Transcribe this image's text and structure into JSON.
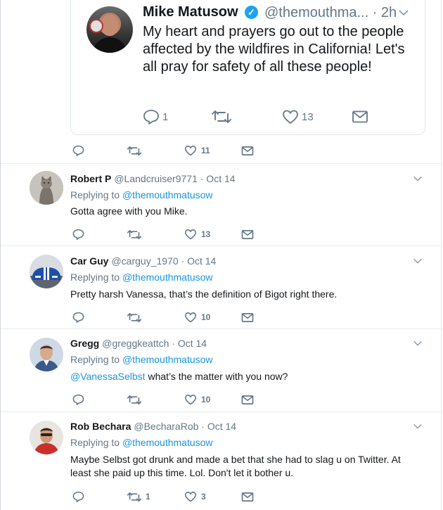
{
  "quoted_tweet": {
    "author_name": "Mike Matusow",
    "verified_icon": "verified-badge-icon",
    "handle_and_time": "@themouthma... · 2h",
    "text": "My heart and prayers go out to the people affected by the wildfires in California! Let's all pray for safety of all these people!",
    "reply_count": "1",
    "retweet_count": "",
    "like_count": "13"
  },
  "main_actions": {
    "reply_count": "",
    "retweet_count": "",
    "like_count": "11"
  },
  "colors": {
    "link": "#1b95e0",
    "verified": "#1da1f2",
    "muted": "#657786",
    "divider": "#e6ecf0"
  },
  "replying_to_label": "Replying to",
  "replies": [
    {
      "name": "Robert P",
      "handle": "@Landcruiser9771",
      "date": "· Oct 14",
      "replying_to": "@themouthmatusow",
      "mention": "",
      "text": "Gotta agree with you Mike.",
      "reply_count": "",
      "retweet_count": "",
      "like_count": "13"
    },
    {
      "name": "Car Guy",
      "handle": "@carguy_1970",
      "date": "· Oct 14",
      "replying_to": "@themouthmatusow",
      "mention": "",
      "text": "Pretty harsh Vanessa, that’s the definition of Bigot right there.",
      "reply_count": "",
      "retweet_count": "",
      "like_count": "10"
    },
    {
      "name": "Gregg",
      "handle": "@greggkeattch",
      "date": "· Oct 14",
      "replying_to": "@themouthmatusow",
      "mention": "@VanessaSelbst",
      "text": " what’s the matter with you now?",
      "reply_count": "",
      "retweet_count": "",
      "like_count": "10"
    },
    {
      "name": "Rob Bechara",
      "handle": "@BecharaRob",
      "date": "· Oct 14",
      "replying_to": "@themouthmatusow",
      "mention": "",
      "text": "Maybe Selbst got drunk and made a bet that she had to slag u on Twitter. At least she paid up this time. Lol. Don't let it bother u.",
      "reply_count": "",
      "retweet_count": "1",
      "like_count": "3"
    }
  ]
}
